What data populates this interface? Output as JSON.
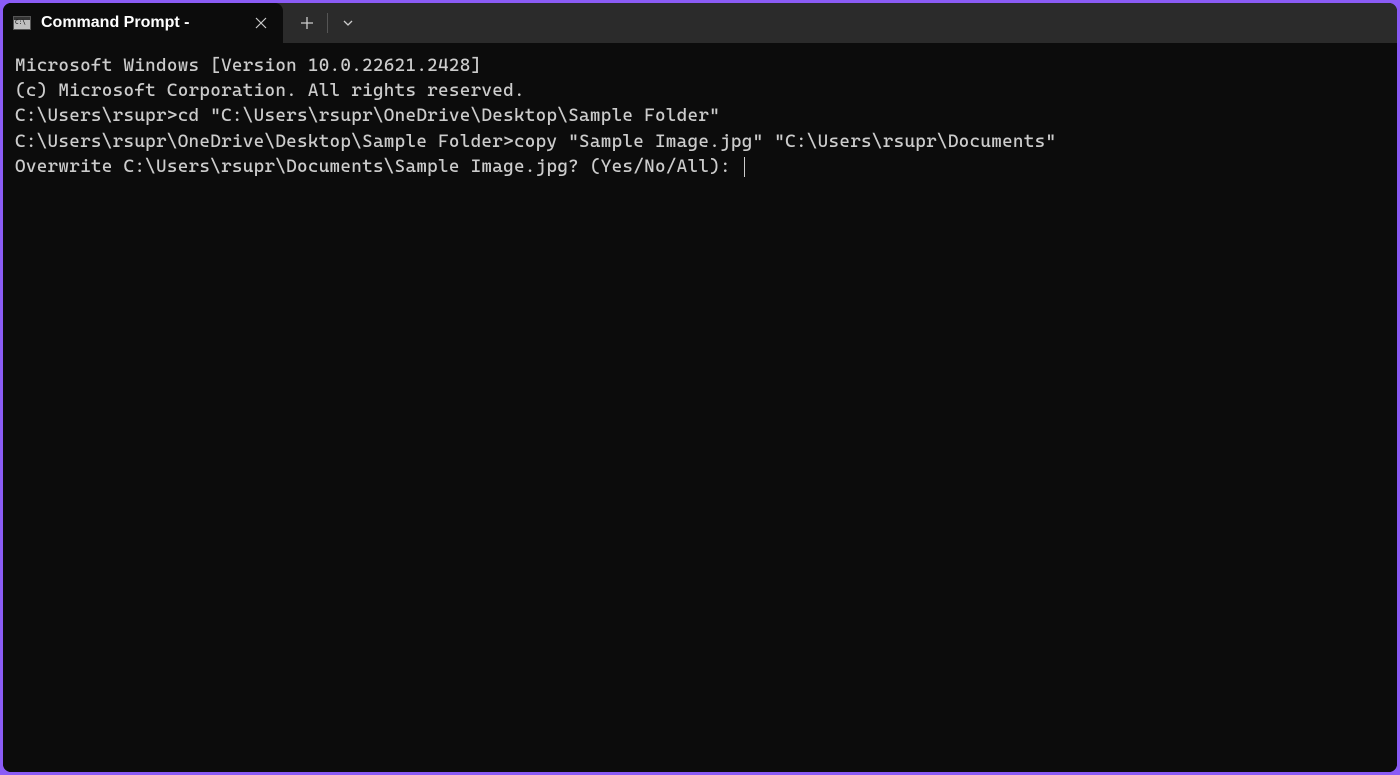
{
  "tab": {
    "title": "Command Prompt -"
  },
  "terminal": {
    "line1": "Microsoft Windows [Version 10.0.22621.2428]",
    "line2": "(c) Microsoft Corporation. All rights reserved.",
    "blank1": "",
    "line3": "C:\\Users\\rsupr>cd \"C:\\Users\\rsupr\\OneDrive\\Desktop\\Sample Folder\"",
    "blank2": "",
    "line4": "C:\\Users\\rsupr\\OneDrive\\Desktop\\Sample Folder>copy \"Sample Image.jpg\" \"C:\\Users\\rsupr\\Documents\"",
    "line5": "Overwrite C:\\Users\\rsupr\\Documents\\Sample Image.jpg? (Yes/No/All): "
  }
}
